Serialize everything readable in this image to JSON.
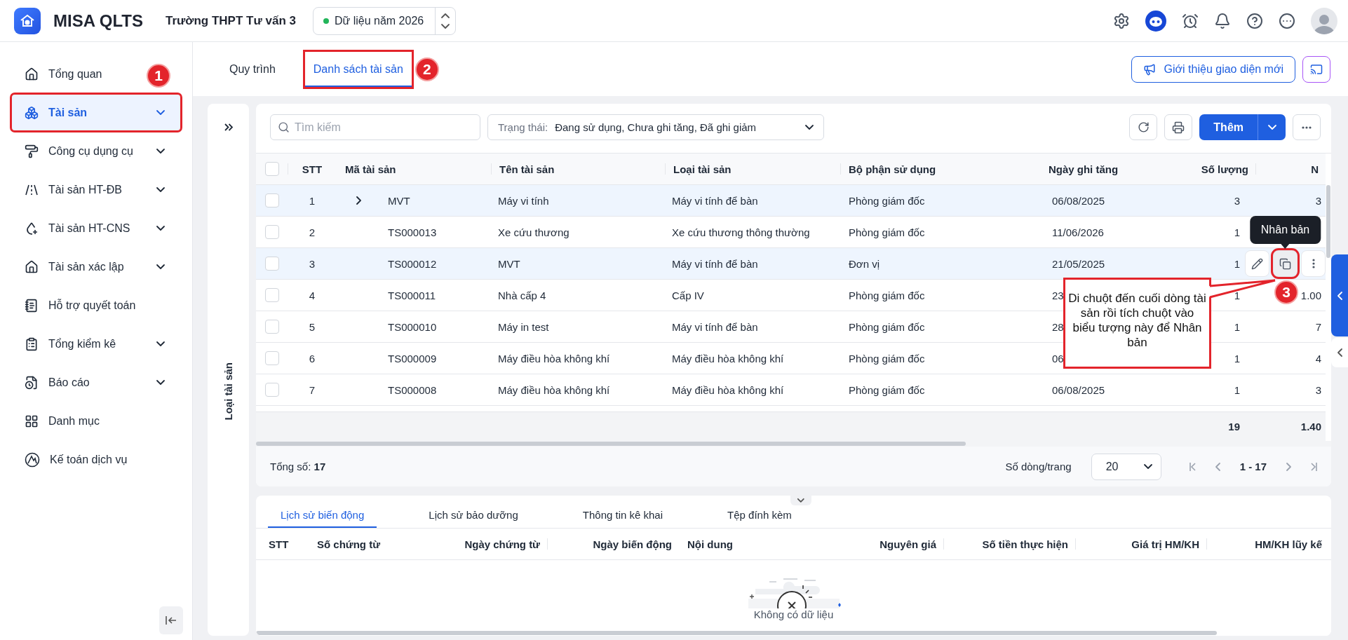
{
  "header": {
    "app_name": "MISA QLTS",
    "organization": "Trường THPT Tư vấn 3",
    "year_selector": {
      "label": "Dữ liệu năm 2026"
    }
  },
  "sidebar": {
    "items": [
      {
        "label": "Tổng quan",
        "expandable": false,
        "selected": false
      },
      {
        "label": "Tài sản",
        "expandable": true,
        "selected": true,
        "annotation": "1"
      },
      {
        "label": "Công cụ dụng cụ",
        "expandable": true,
        "selected": false
      },
      {
        "label": "Tài sản HT-ĐB",
        "expandable": true,
        "selected": false
      },
      {
        "label": "Tài sản HT-CNS",
        "expandable": true,
        "selected": false
      },
      {
        "label": "Tài sản xác lập",
        "expandable": true,
        "selected": false
      },
      {
        "label": "Hỗ trợ quyết toán",
        "expandable": false,
        "selected": false
      },
      {
        "label": "Tổng kiểm kê",
        "expandable": true,
        "selected": false
      },
      {
        "label": "Báo cáo",
        "expandable": true,
        "selected": false
      },
      {
        "label": "Danh mục",
        "expandable": false,
        "selected": false
      },
      {
        "label": "Kế toán dịch vụ",
        "expandable": false,
        "selected": false
      }
    ]
  },
  "tabs": [
    {
      "label": "Quy trình",
      "selected": false
    },
    {
      "label": "Danh sách tài sản",
      "selected": true,
      "annotation": "2"
    }
  ],
  "intro_button": "Giới thiệu giao diện mới",
  "side_panel": {
    "label": "Loại tài sản"
  },
  "toolbar": {
    "search": {
      "placeholder": "Tìm kiếm"
    },
    "status_filter": {
      "label": "Trạng thái:",
      "value": "Đang sử dụng, Chưa ghi tăng, Đã ghi giảm"
    },
    "add_button": "Thêm"
  },
  "table": {
    "all_checked": false,
    "columns": [
      "STT",
      "Mã tài sản",
      "Tên tài sản",
      "Loại tài sản",
      "Bộ phận sử dụng",
      "Ngày ghi tăng",
      "Số lượng",
      "N"
    ],
    "rows": [
      {
        "checked": false,
        "highlighted": true,
        "expandable": true,
        "stt": "1",
        "code": "MVT",
        "name": "Máy vi tính",
        "type": "Máy vi tính để bàn",
        "department": "Phòng giám đốc",
        "date": "06/08/2025",
        "quantity": "3",
        "column_9": "3"
      },
      {
        "checked": false,
        "highlighted": false,
        "expandable": false,
        "stt": "2",
        "code": "TS000013",
        "name": "Xe cứu thương",
        "type": "Xe cứu thương thông thường",
        "department": "Phòng giám đốc",
        "date": "11/06/2026",
        "quantity": "1"
      },
      {
        "checked": false,
        "highlighted": true,
        "expandable": false,
        "stt": "3",
        "code": "TS000012",
        "name": "MVT",
        "type": "Máy vi tính để bàn",
        "department": "Đơn vị",
        "date": "21/05/2025",
        "quantity": "1",
        "actions": {
          "tooltip": "Nhân bản",
          "annotation": "3"
        }
      },
      {
        "checked": false,
        "highlighted": false,
        "expandable": false,
        "stt": "4",
        "code": "TS000011",
        "name": "Nhà cấp 4",
        "type": "Cấp IV",
        "department": "Phòng giám đốc",
        "date": "23",
        "quantity": "1",
        "column_9": "1.00"
      },
      {
        "checked": false,
        "highlighted": false,
        "expandable": false,
        "stt": "5",
        "code": "TS000010",
        "name": "Máy in test",
        "type": "Máy vi tính để bàn",
        "department": "Phòng giám đốc",
        "date": "28",
        "quantity": "1",
        "column_9": "7"
      },
      {
        "checked": false,
        "highlighted": false,
        "expandable": false,
        "stt": "6",
        "code": "TS000009",
        "name": "Máy điều hòa không khí",
        "type": "Máy điều hòa không khí",
        "department": "Phòng giám đốc",
        "date": "06",
        "quantity": "1",
        "column_9": "4"
      },
      {
        "checked": false,
        "highlighted": false,
        "expandable": false,
        "stt": "7",
        "code": "TS000008",
        "name": "Máy điều hòa không khí",
        "type": "Máy điều hòa không khí",
        "department": "Phòng giám đốc",
        "date": "06/08/2025",
        "quantity": "1",
        "column_9": "3"
      }
    ],
    "totals": {
      "quantity": "19",
      "column_9": "1.40"
    }
  },
  "pagination": {
    "total_label": "Tổng số:",
    "total": "17",
    "page_size_label": "Số dòng/trang",
    "page_size": "20",
    "range": "1 - 17"
  },
  "detail": {
    "tabs": [
      {
        "label": "Lịch sử biến động",
        "selected": true
      },
      {
        "label": "Lịch sử bảo dưỡng",
        "selected": false
      },
      {
        "label": "Thông tin kê khai",
        "selected": false
      },
      {
        "label": "Tệp đính kèm",
        "selected": false
      }
    ],
    "columns": [
      "STT",
      "Số chứng từ",
      "Ngày chứng từ",
      "Ngày biến động",
      "Nội dung",
      "Nguyên giá",
      "Số tiền thực hiện",
      "Giá trị HM/KH",
      "HM/KH lũy kế"
    ],
    "empty_text": "Không có dữ liệu"
  },
  "callout": {
    "text": "Di chuột đến cuối dòng tài sản rồi tích chuột vào biểu tượng này để Nhân bản"
  }
}
